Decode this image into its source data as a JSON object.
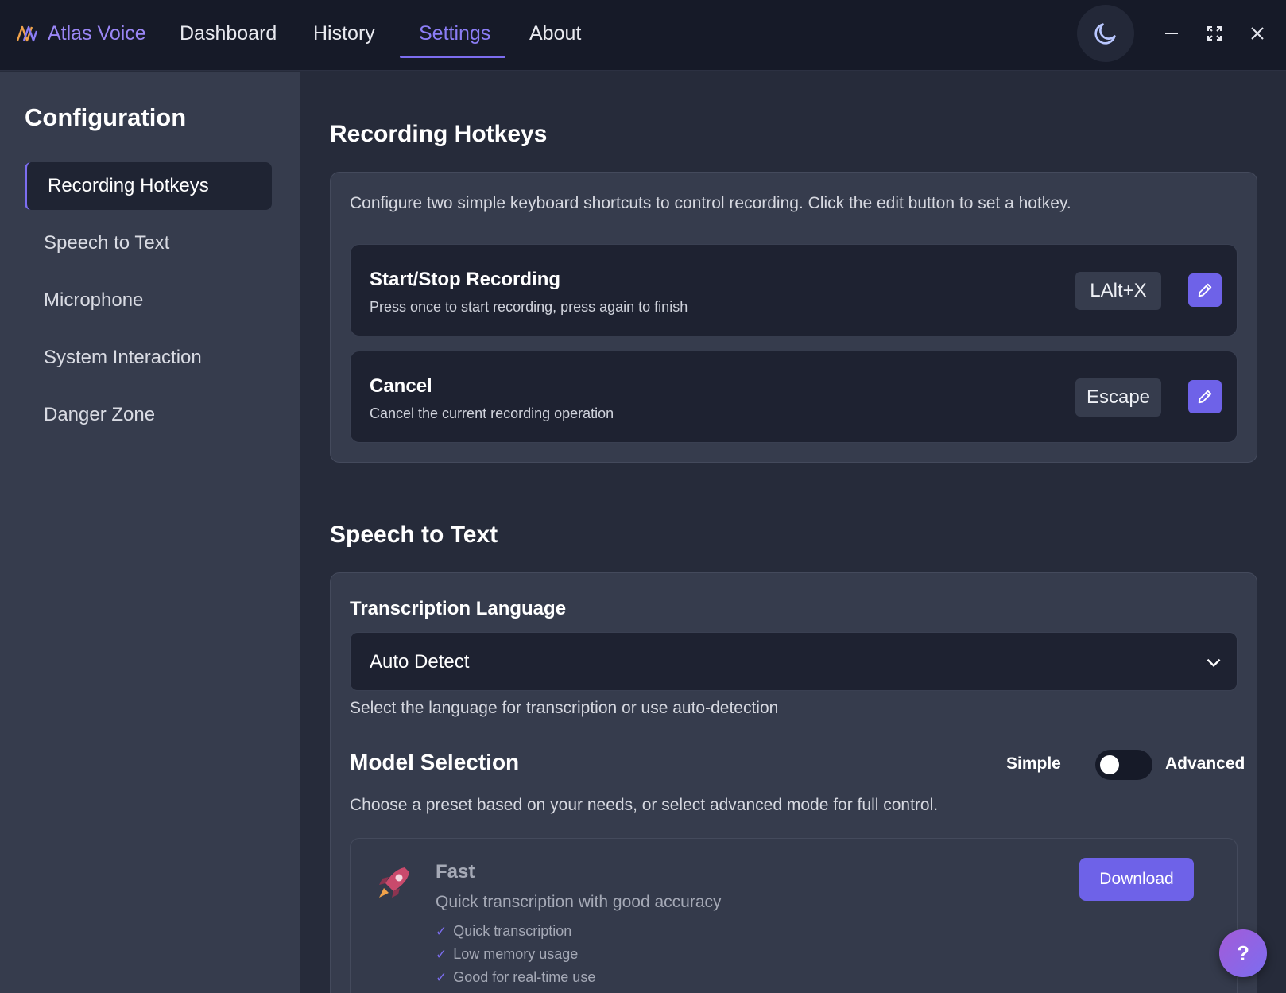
{
  "app": {
    "name": "Atlas Voice"
  },
  "nav": {
    "tabs": [
      "Dashboard",
      "History",
      "Settings",
      "About"
    ],
    "active": "Settings"
  },
  "sidebar": {
    "title": "Configuration",
    "items": [
      {
        "label": "Recording Hotkeys",
        "active": true
      },
      {
        "label": "Speech to Text",
        "active": false
      },
      {
        "label": "Microphone",
        "active": false
      },
      {
        "label": "System Interaction",
        "active": false
      },
      {
        "label": "Danger Zone",
        "active": false
      }
    ]
  },
  "hotkeys": {
    "title": "Recording Hotkeys",
    "description": "Configure two simple keyboard shortcuts to control recording. Click the edit button to set a hotkey.",
    "rows": [
      {
        "title": "Start/Stop Recording",
        "subtitle": "Press once to start recording, press again to finish",
        "key": "LAlt+X"
      },
      {
        "title": "Cancel",
        "subtitle": "Cancel the current recording operation",
        "key": "Escape"
      }
    ]
  },
  "speech": {
    "title": "Speech to Text",
    "language_label": "Transcription Language",
    "language_value": "Auto Detect",
    "language_help": "Select the language for transcription or use auto-detection",
    "model_title": "Model Selection",
    "toggle_left": "Simple",
    "toggle_right": "Advanced",
    "model_help": "Choose a preset based on your needs, or select advanced mode for full control.",
    "preset": {
      "name": "Fast",
      "description": "Quick transcription with good accuracy",
      "features": [
        "Quick transcription",
        "Low memory usage",
        "Good for real-time use"
      ],
      "button": "Download"
    }
  },
  "help_button": "?",
  "colors": {
    "accent": "#7c6df0",
    "topbar": "#161a28",
    "sidebar": "#363c4d",
    "background": "#262b3a"
  }
}
